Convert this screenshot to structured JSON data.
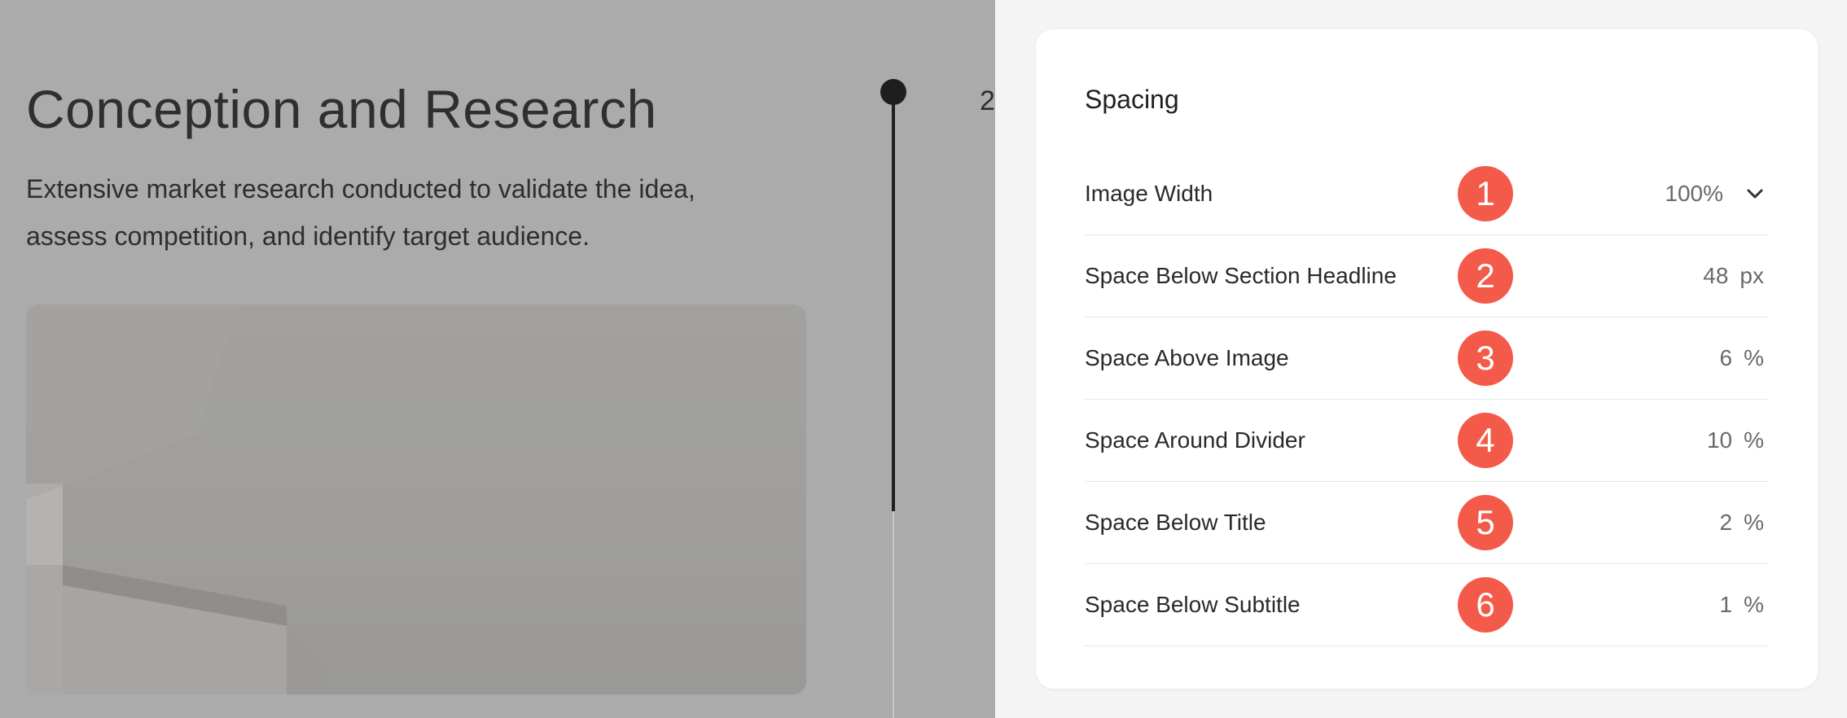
{
  "preview": {
    "title": "Conception and Research",
    "description_line1": "Extensive market research conducted to validate the idea,",
    "description_line2": "assess competition, and identify target audience.",
    "timeline_number": "2"
  },
  "panel": {
    "title": "Spacing",
    "rows": [
      {
        "label": "Image Width",
        "badge": "1",
        "value": "100%",
        "unit": "",
        "control": "chevron-down-icon"
      },
      {
        "label": "Space Below Section Headline",
        "badge": "2",
        "value": "48",
        "unit": "px"
      },
      {
        "label": "Space Above Image",
        "badge": "3",
        "value": "6",
        "unit": "%"
      },
      {
        "label": "Space Around Divider",
        "badge": "4",
        "value": "10",
        "unit": "%"
      },
      {
        "label": "Space Below Title",
        "badge": "5",
        "value": "2",
        "unit": "%"
      },
      {
        "label": "Space Below Subtitle",
        "badge": "6",
        "value": "1",
        "unit": "%"
      }
    ]
  },
  "colors": {
    "badge": "#f45a4a",
    "overlay": "#ababab",
    "panel_bg": "#ffffff"
  }
}
